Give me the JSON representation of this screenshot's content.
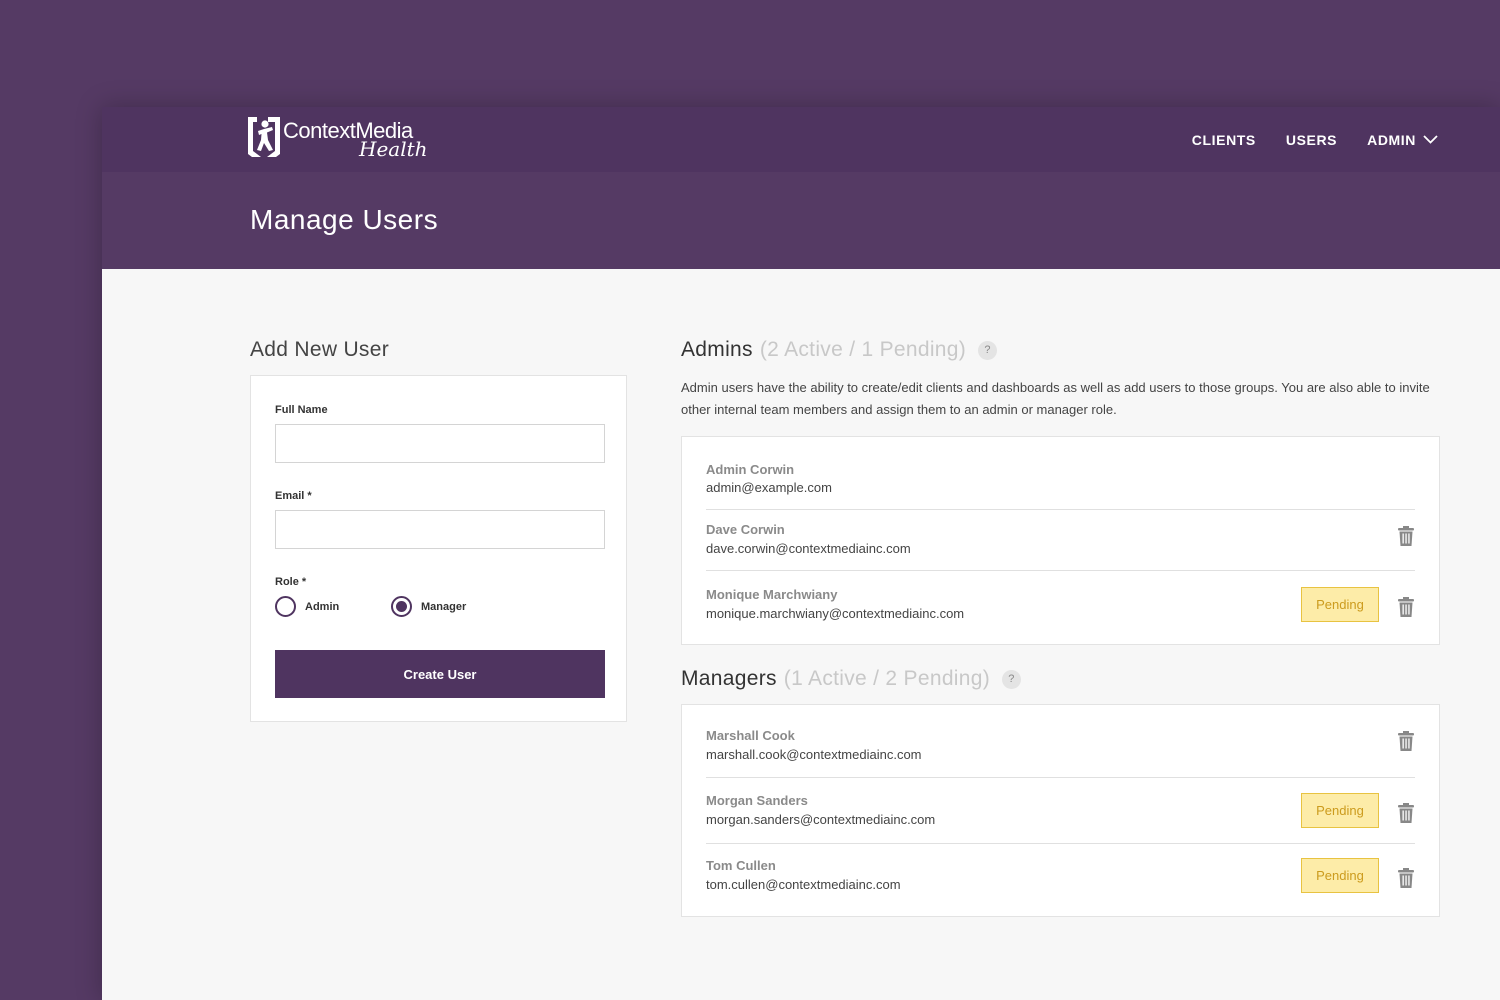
{
  "brand": {
    "name": "ContextMedia",
    "sub": "Health"
  },
  "nav": {
    "clients": "CLIENTS",
    "users": "USERS",
    "admin": "ADMIN"
  },
  "page_title": "Manage Users",
  "form": {
    "heading": "Add New User",
    "full_name_label": "Full Name",
    "full_name_value": "",
    "email_label": "Email *",
    "email_value": "",
    "role_label": "Role *",
    "role_options": [
      "Admin",
      "Manager"
    ],
    "role_selected": "Manager",
    "submit_label": "Create User"
  },
  "admins": {
    "title": "Admins",
    "count": "(2 Active / 1 Pending)",
    "help": "?",
    "description": "Admin users have the ability to create/edit clients and dashboards as well as add users to those groups. You are also able to invite other internal team members and assign them to an admin or manager role.",
    "users": [
      {
        "name": "Admin Corwin",
        "email": "admin@example.com",
        "pending": false,
        "deletable": false
      },
      {
        "name": "Dave Corwin",
        "email": "dave.corwin@contextmediainc.com",
        "pending": false,
        "deletable": true
      },
      {
        "name": "Monique Marchwiany",
        "email": "monique.marchwiany@contextmediainc.com",
        "pending": true,
        "deletable": true
      }
    ]
  },
  "managers": {
    "title": "Managers",
    "count": "(1 Active / 2 Pending)",
    "help": "?",
    "users": [
      {
        "name": "Marshall Cook",
        "email": "marshall.cook@contextmediainc.com",
        "pending": false,
        "deletable": true
      },
      {
        "name": "Morgan Sanders",
        "email": "morgan.sanders@contextmediainc.com",
        "pending": true,
        "deletable": true
      },
      {
        "name": "Tom Cullen",
        "email": "tom.cullen@contextmediainc.com",
        "pending": true,
        "deletable": true
      }
    ]
  },
  "pending_label": "Pending",
  "colors": {
    "brand_purple": "#4f3460",
    "header_purple": "#553a64",
    "pending_bg": "#fdeca8",
    "pending_text": "#cc9b1d"
  }
}
